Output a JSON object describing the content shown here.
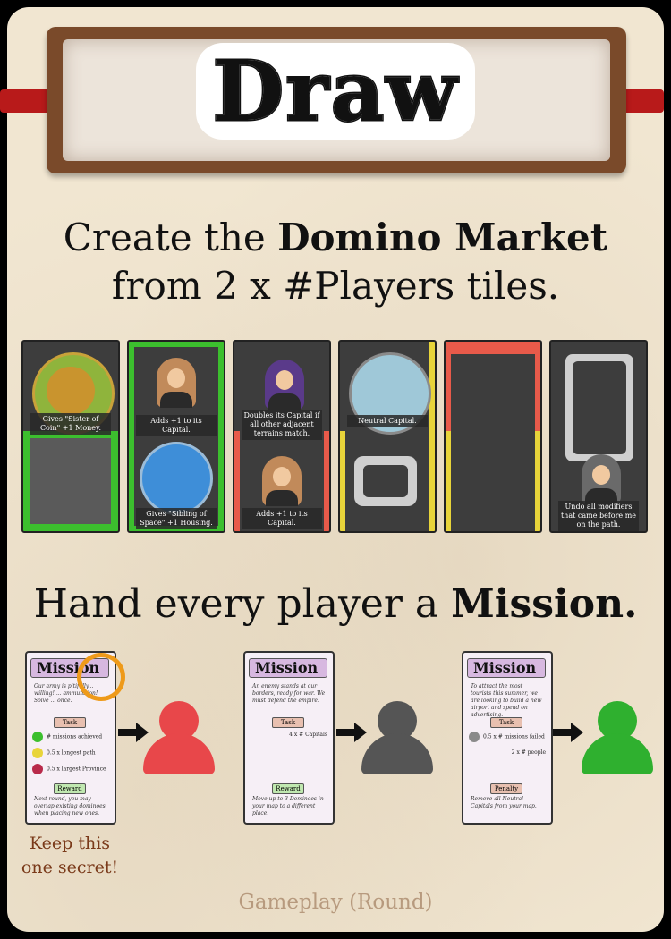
{
  "header": {
    "title": "Draw"
  },
  "step1": {
    "line1_prefix": "Create the ",
    "line1_bold": "Domino Market",
    "line2": "from 2 x #Players tiles."
  },
  "tiles": [
    {
      "label": "Gives \"Sister of Coin\" +1 Money."
    },
    {
      "label_top": "Adds +1 to its Capital.",
      "label_bottom": "Gives \"Sibling of Space\" +1 Housing."
    },
    {
      "label_top": "Doubles its Capital if all other adjacent terrains match.",
      "label_bottom": "Adds +1 to its Capital."
    },
    {
      "label": "Neutral Capital."
    },
    {},
    {
      "label": "Undo all modifiers that came before me on the path."
    }
  ],
  "step2": {
    "prefix": "Hand every player a ",
    "bold": "Mission."
  },
  "missions": [
    {
      "title": "Mission",
      "flavor": "Our army is pitifully... willing! ... ammunition! Solve ... once.",
      "task_label": "Task",
      "rows": [
        "# missions achieved",
        "0.5 x longest path",
        "0.5 x largest Province"
      ],
      "reward_label": "Reward",
      "footer": "Next round, you may overlap existing dominoes when placing new ones.",
      "player_color": "#e8474a"
    },
    {
      "title": "Mission",
      "flavor": "An enemy stands at our borders, ready for war. We must defend the empire.",
      "task_label": "Task",
      "rows": [
        "4 x # Capitals"
      ],
      "reward_label": "Reward",
      "footer": "Move up to 3 Dominoes in your map to a different place.",
      "player_color": "#555555"
    },
    {
      "title": "Mission",
      "flavor": "To attract the most tourists this summer, we are looking to build a new airport and spend on advertising.",
      "task_label": "Task",
      "rows": [
        "0.5 x # missions failed",
        "2 x # people"
      ],
      "reward_label": "Penalty",
      "footer": "Remove all Neutral Capitals from your map.",
      "player_color": "#2fb02f"
    }
  ],
  "note": {
    "line1": "Keep this",
    "line2": "one secret!"
  },
  "footer": {
    "text": "Gameplay (Round)"
  }
}
